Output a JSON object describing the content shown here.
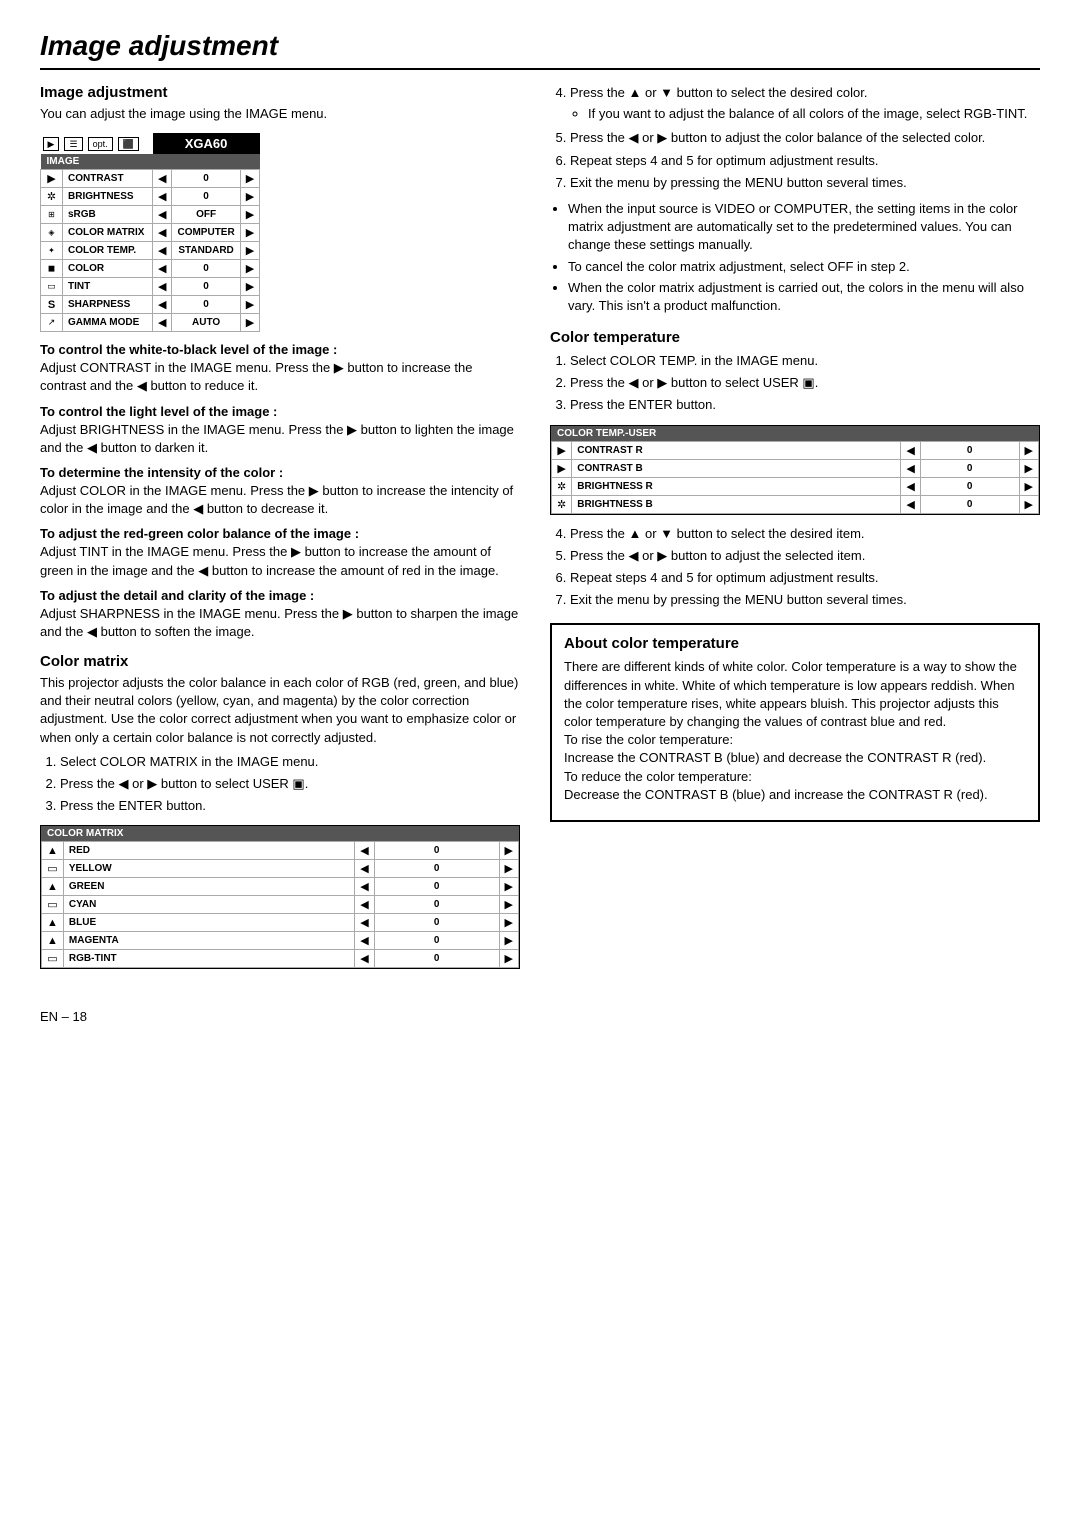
{
  "page": {
    "title": "Image adjustment",
    "footer": "EN – 18"
  },
  "left": {
    "image_adjustment": {
      "heading": "Image adjustment",
      "intro": "You can adjust the image using the IMAGE menu.",
      "menu": {
        "xga_label": "XGA60",
        "section_label": "IMAGE",
        "rows": [
          {
            "icon": "▶",
            "label": "CONTRAST",
            "value": "0"
          },
          {
            "icon": "☀",
            "label": "BRIGHTNESS",
            "value": "0"
          },
          {
            "icon": "⊞",
            "label": "sRGB",
            "value": "OFF"
          },
          {
            "icon": "◈",
            "label": "COLOR MATRIX",
            "value": "COMPUTER"
          },
          {
            "icon": "✦",
            "label": "COLOR TEMP.",
            "value": "STANDARD"
          },
          {
            "icon": "◼",
            "label": "COLOR",
            "value": "0"
          },
          {
            "icon": "▭",
            "label": "TINT",
            "value": "0"
          },
          {
            "icon": "S",
            "label": "SHARPNESS",
            "value": "0"
          },
          {
            "icon": "↗",
            "label": "GAMMA MODE",
            "value": "AUTO"
          }
        ]
      },
      "sections": [
        {
          "heading": "To control the white-to-black level of the image :",
          "text": "Adjust CONTRAST in the IMAGE menu.  Press the ▶ button to increase the contrast and the ◀ button to reduce it."
        },
        {
          "heading": "To control the light level of the image :",
          "text": "Adjust BRIGHTNESS in the IMAGE menu.  Press the ▶ button to lighten the image and the ◀ button to darken it."
        },
        {
          "heading": "To determine the intensity of the color :",
          "text": "Adjust COLOR in the IMAGE menu.  Press the ▶ button to increase the intencity of color in the image and the ◀ button to decrease it."
        },
        {
          "heading": "To adjust the red-green color balance of the image :",
          "text": "Adjust TINT in the IMAGE menu.  Press the ▶ button to increase the amount of green in the image and the ◀ button to increase the amount of red in the image."
        },
        {
          "heading": "To adjust the detail and clarity of the image :",
          "text": "Adjust SHARPNESS in the IMAGE menu.  Press the ▶ button to sharpen the image and the ◀ button to soften the image."
        }
      ]
    },
    "color_matrix": {
      "heading": "Color matrix",
      "intro": "This projector adjusts the color balance in each color of RGB (red, green, and blue) and their neutral colors (yellow, cyan, and magenta) by the color correction adjustment. Use the color correct adjustment when you want to emphasize color or when only a certain color balance is not correctly adjusted.",
      "steps": [
        "Select COLOR MATRIX in the IMAGE menu.",
        "Press the ◀ or ▶ button to select USER ▣.",
        "Press the ENTER button."
      ],
      "matrix_table": {
        "header": "COLOR MATRIX",
        "rows": [
          {
            "icon": "▲",
            "label": "RED",
            "value": "0"
          },
          {
            "icon": "▭",
            "label": "YELLOW",
            "value": "0"
          },
          {
            "icon": "▲",
            "label": "GREEN",
            "value": "0"
          },
          {
            "icon": "▭",
            "label": "CYAN",
            "value": "0"
          },
          {
            "icon": "▲",
            "label": "BLUE",
            "value": "0"
          },
          {
            "icon": "▲",
            "label": "MAGENTA",
            "value": "0"
          },
          {
            "icon": "▭",
            "label": "RGB-TINT",
            "value": "0"
          }
        ]
      }
    }
  },
  "right": {
    "steps_continued": [
      "Press the ▲ or ▼ button to select the desired color.",
      "If you want to adjust the balance of all colors of the image, select RGB-TINT.",
      "Press the ◀ or ▶ button to adjust the color balance of the selected color.",
      "Repeat steps 4 and 5 for optimum adjustment results.",
      "Exit the menu by pressing the MENU button several times."
    ],
    "bullets": [
      "When the input source is VIDEO or COMPUTER, the setting items in the color matrix adjustment are automatically set to the predetermined values. You can change these settings manually.",
      "To cancel the color matrix adjustment, select OFF in step 2.",
      "When the color matrix adjustment is carried out, the colors in the menu will also vary. This isn't a product malfunction."
    ],
    "color_temperature": {
      "heading": "Color temperature",
      "steps": [
        "Select COLOR TEMP. in the IMAGE menu.",
        "Press the ◀ or ▶ button to select USER ▣.",
        "Press the ENTER button."
      ],
      "temp_table": {
        "header": "COLOR TEMP.-USER",
        "rows": [
          {
            "icon": "▶",
            "label": "CONTRAST R",
            "value": "0"
          },
          {
            "icon": "▶",
            "label": "CONTRAST B",
            "value": "0"
          },
          {
            "icon": "☀",
            "label": "BRIGHTNESS R",
            "value": "0"
          },
          {
            "icon": "☀",
            "label": "BRIGHTNESS B",
            "value": "0"
          }
        ]
      },
      "steps_after": [
        "Press the ▲ or ▼ button to select the desired item.",
        "Press the ◀ or ▶ button to adjust the selected item.",
        "Repeat steps 4 and 5 for optimum adjustment results.",
        "Exit the menu by pressing the MENU button several times."
      ]
    },
    "about_color_temp": {
      "heading": "About color temperature",
      "text": "There are different kinds of white color. Color temperature is a way to show the differences in white. White of which temperature is low appears reddish. When the color temperature rises, white appears bluish. This projector adjusts this color temperature by changing the values of contrast blue and red.\nTo rise the color temperature:\nIncrease the CONTRAST B (blue) and decrease the CONTRAST R (red).\nTo reduce the color temperature:\nDecrease the CONTRAST B (blue) and increase the CONTRAST R (red)."
    }
  }
}
